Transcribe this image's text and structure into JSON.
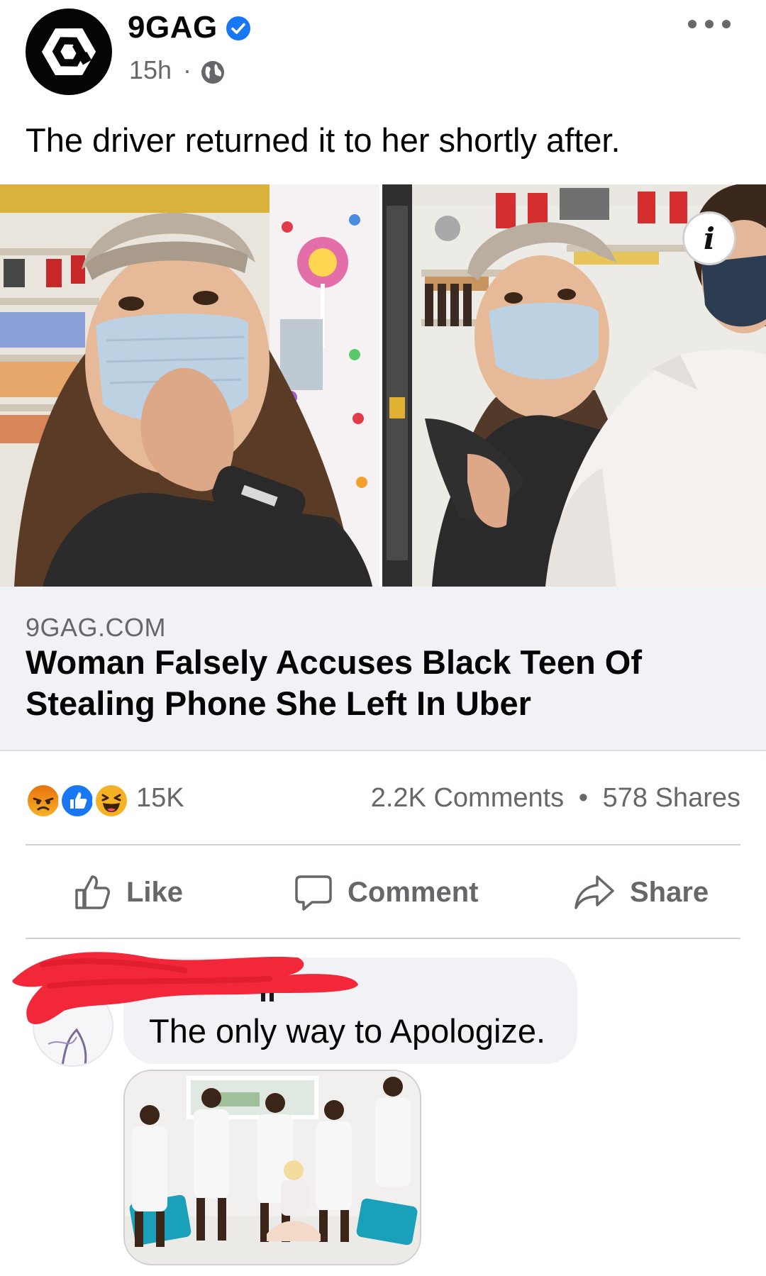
{
  "post": {
    "page_name": "9GAG",
    "time": "15h",
    "separator": "·",
    "caption": "The driver returned it to her shortly after.",
    "icons": [
      "9gag-logo-icon",
      "verified-badge-icon",
      "globe-icon",
      "more-options-icon"
    ]
  },
  "photos": {
    "info_glyph": "i"
  },
  "link_preview": {
    "domain": "9GAG.COM",
    "title": "Woman Falsely Accuses Black Teen Of Stealing Phone She Left In Uber"
  },
  "reactions": {
    "types": [
      "angry",
      "like",
      "haha"
    ],
    "count": "15K",
    "comments": "2.2K Comments",
    "dot": "•",
    "shares": "578 Shares"
  },
  "actions": {
    "like": "Like",
    "comment": "Comment",
    "share": "Share"
  },
  "comment": {
    "text": "The only way to Apologize."
  },
  "colors": {
    "secondary_text": "#65676b",
    "verified_blue": "#1877f2",
    "link_box_bg": "#f0f2f5",
    "angry_orange": "#e9710f",
    "haha_yellow": "#f7b125",
    "redaction_red": "#f2283a"
  }
}
